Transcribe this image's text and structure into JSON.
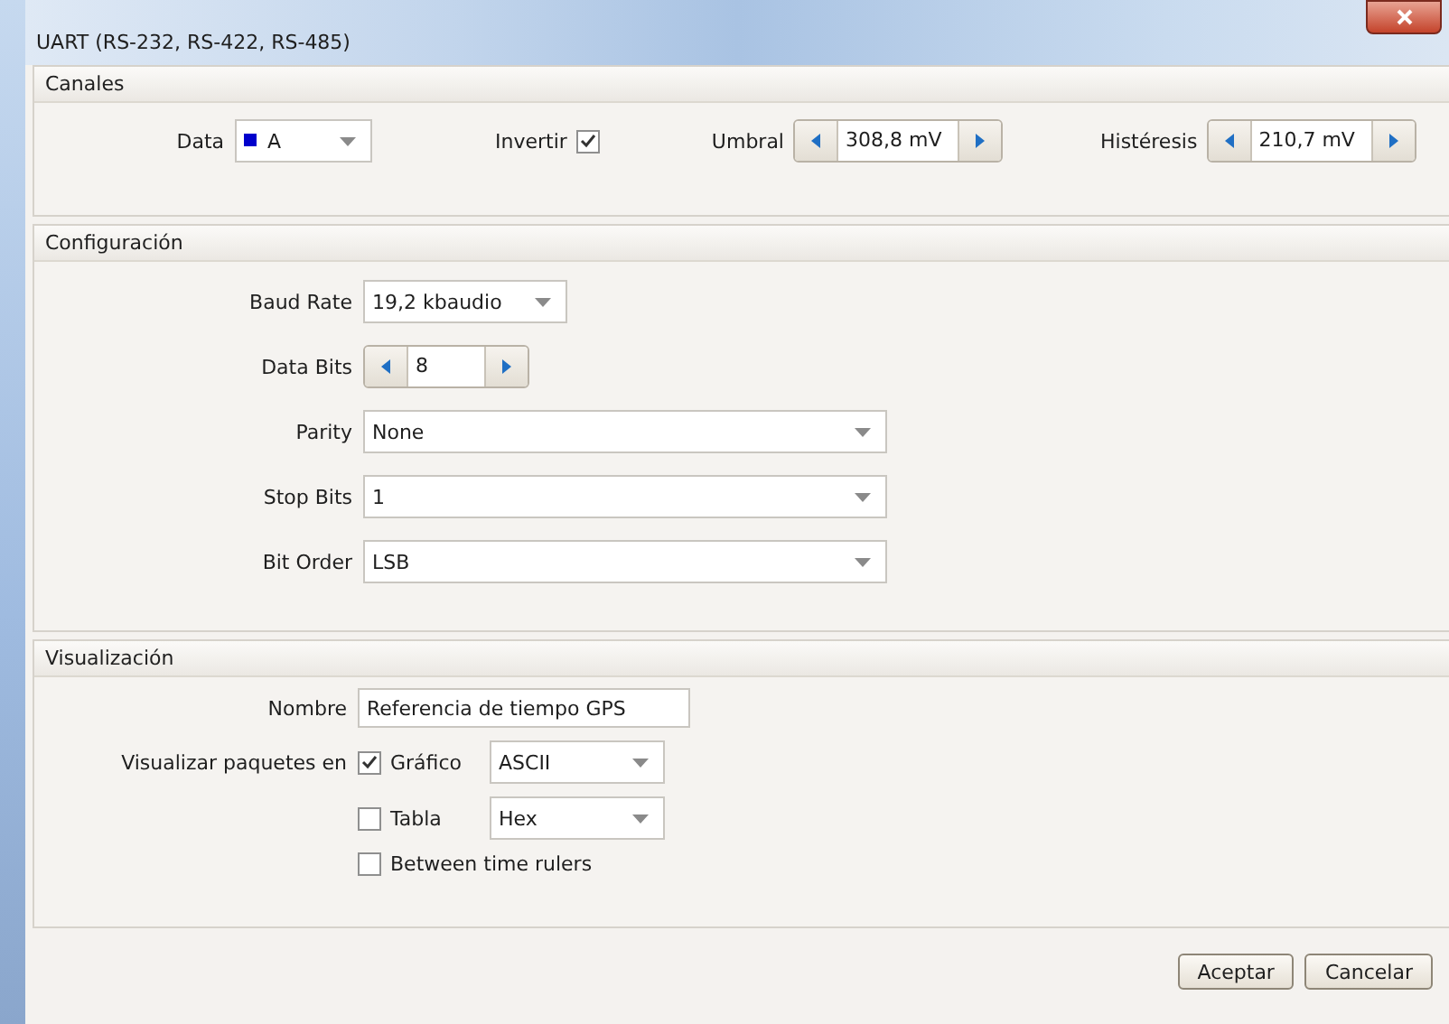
{
  "window": {
    "title": "UART (RS-232, RS-422, RS-485)"
  },
  "canales": {
    "title": "Canales",
    "data": {
      "label": "Data",
      "value": "A",
      "color": "#0000cc"
    },
    "invert": {
      "label": "Invertir",
      "checked": true
    },
    "threshold": {
      "label": "Umbral",
      "value": "308,8 mV"
    },
    "hysteresis": {
      "label": "Histéresis",
      "value": "210,7 mV"
    }
  },
  "configuracion": {
    "title": "Configuración",
    "fields": [
      {
        "kind": "combo",
        "label": "Baud Rate",
        "value": "19,2 kbaudio"
      },
      {
        "kind": "spinner",
        "label": "Data Bits",
        "value": "8"
      },
      {
        "kind": "select",
        "label": "Parity",
        "value": "None"
      },
      {
        "kind": "select",
        "label": "Stop Bits",
        "value": "1"
      },
      {
        "kind": "select",
        "label": "Bit Order",
        "value": "LSB"
      }
    ]
  },
  "visualizacion": {
    "title": "Visualización",
    "name": {
      "label": "Nombre",
      "value": "Referencia de tiempo GPS"
    },
    "packets": {
      "label": "Visualizar paquetes en",
      "options": [
        {
          "label": "Gráfico",
          "checked": true,
          "format": "ASCII"
        },
        {
          "label": "Tabla",
          "checked": false,
          "format": "Hex"
        }
      ]
    },
    "between": {
      "label": "Between time rulers",
      "checked": false
    }
  },
  "buttons": [
    "Aceptar",
    "Cancelar"
  ]
}
